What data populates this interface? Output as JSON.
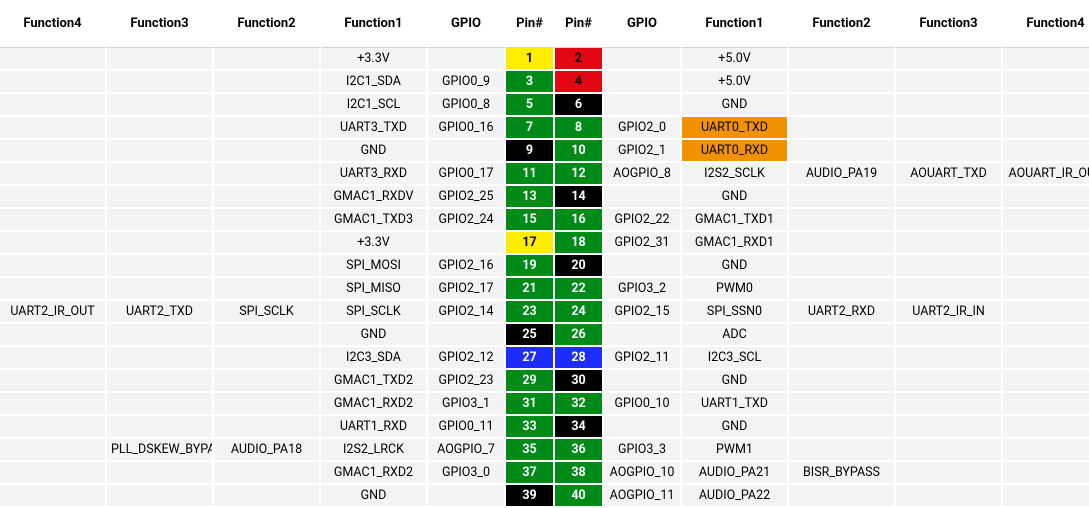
{
  "headers": {
    "f4l": "Function4",
    "f3l": "Function3",
    "f2l": "Function2",
    "f1l": "Function1",
    "gpiol": "GPIO",
    "pinl": "Pin#",
    "pinr": "Pin#",
    "gpior": "GPIO",
    "f1r": "Function1",
    "f2r": "Function2",
    "f3r": "Function3",
    "f4r": "Function4"
  },
  "rows": [
    {
      "f4l": "",
      "f3l": "",
      "f2l": "",
      "f1l": "+3.3V",
      "gpiol": "",
      "pinl": {
        "n": "1",
        "c": "yellow"
      },
      "pinr": {
        "n": "2",
        "c": "red"
      },
      "gpior": "",
      "f1r": "+5.0V",
      "f1rC": "",
      "f2r": "",
      "f3r": "",
      "f4r": ""
    },
    {
      "f4l": "",
      "f3l": "",
      "f2l": "",
      "f1l": "I2C1_SDA",
      "gpiol": "GPIO0_9",
      "pinl": {
        "n": "3",
        "c": "green"
      },
      "pinr": {
        "n": "4",
        "c": "red"
      },
      "gpior": "",
      "f1r": "+5.0V",
      "f1rC": "",
      "f2r": "",
      "f3r": "",
      "f4r": ""
    },
    {
      "f4l": "",
      "f3l": "",
      "f2l": "",
      "f1l": "I2C1_SCL",
      "gpiol": "GPIO0_8",
      "pinl": {
        "n": "5",
        "c": "green"
      },
      "pinr": {
        "n": "6",
        "c": "black"
      },
      "gpior": "",
      "f1r": "GND",
      "f1rC": "",
      "f2r": "",
      "f3r": "",
      "f4r": ""
    },
    {
      "f4l": "",
      "f3l": "",
      "f2l": "",
      "f1l": "UART3_TXD",
      "gpiol": "GPIO0_16",
      "pinl": {
        "n": "7",
        "c": "green"
      },
      "pinr": {
        "n": "8",
        "c": "green"
      },
      "gpior": "GPIO2_0",
      "f1r": "UART0_TXD",
      "f1rC": "orange",
      "f2r": "",
      "f3r": "",
      "f4r": ""
    },
    {
      "f4l": "",
      "f3l": "",
      "f2l": "",
      "f1l": "GND",
      "gpiol": "",
      "pinl": {
        "n": "9",
        "c": "black"
      },
      "pinr": {
        "n": "10",
        "c": "green"
      },
      "gpior": "GPIO2_1",
      "f1r": "UART0_RXD",
      "f1rC": "orange",
      "f2r": "",
      "f3r": "",
      "f4r": ""
    },
    {
      "f4l": "",
      "f3l": "",
      "f2l": "",
      "f1l": "UART3_RXD",
      "gpiol": "GPIO0_17",
      "pinl": {
        "n": "11",
        "c": "green"
      },
      "pinr": {
        "n": "12",
        "c": "green"
      },
      "gpior": "AOGPIO_8",
      "f1r": "I2S2_SCLK",
      "f1rC": "",
      "f2r": "AUDIO_PA19",
      "f3r": "AOUART_TXD",
      "f4r": "AOUART_IR_OUT"
    },
    {
      "f4l": "",
      "f3l": "",
      "f2l": "",
      "f1l": "GMAC1_RXDV",
      "gpiol": "GPIO2_25",
      "pinl": {
        "n": "13",
        "c": "green"
      },
      "pinr": {
        "n": "14",
        "c": "black"
      },
      "gpior": "",
      "f1r": "GND",
      "f1rC": "",
      "f2r": "",
      "f3r": "",
      "f4r": ""
    },
    {
      "f4l": "",
      "f3l": "",
      "f2l": "",
      "f1l": "GMAC1_TXD3",
      "gpiol": "GPIO2_24",
      "pinl": {
        "n": "15",
        "c": "green"
      },
      "pinr": {
        "n": "16",
        "c": "green"
      },
      "gpior": "GPIO2_22",
      "f1r": "GMAC1_TXD1",
      "f1rC": "",
      "f2r": "",
      "f3r": "",
      "f4r": ""
    },
    {
      "f4l": "",
      "f3l": "",
      "f2l": "",
      "f1l": "+3.3V",
      "gpiol": "",
      "pinl": {
        "n": "17",
        "c": "yellow"
      },
      "pinr": {
        "n": "18",
        "c": "green"
      },
      "gpior": "GPIO2_31",
      "f1r": "GMAC1_RXD1",
      "f1rC": "",
      "f2r": "",
      "f3r": "",
      "f4r": ""
    },
    {
      "f4l": "",
      "f3l": "",
      "f2l": "",
      "f1l": "SPI_MOSI",
      "gpiol": "GPIO2_16",
      "pinl": {
        "n": "19",
        "c": "green"
      },
      "pinr": {
        "n": "20",
        "c": "black"
      },
      "gpior": "",
      "f1r": "GND",
      "f1rC": "",
      "f2r": "",
      "f3r": "",
      "f4r": ""
    },
    {
      "f4l": "",
      "f3l": "",
      "f2l": "",
      "f1l": "SPI_MISO",
      "gpiol": "GPIO2_17",
      "pinl": {
        "n": "21",
        "c": "green"
      },
      "pinr": {
        "n": "22",
        "c": "green"
      },
      "gpior": "GPIO3_2",
      "f1r": "PWM0",
      "f1rC": "",
      "f2r": "",
      "f3r": "",
      "f4r": ""
    },
    {
      "f4l": "UART2_IR_OUT",
      "f3l": "UART2_TXD",
      "f2l": "SPI_SCLK",
      "f1l": "SPI_SCLK",
      "gpiol": "GPIO2_14",
      "pinl": {
        "n": "23",
        "c": "green"
      },
      "pinr": {
        "n": "24",
        "c": "green"
      },
      "gpior": "GPIO2_15",
      "f1r": "SPI_SSN0",
      "f1rC": "",
      "f2r": "UART2_RXD",
      "f3r": "UART2_IR_IN",
      "f4r": ""
    },
    {
      "f4l": "",
      "f3l": "",
      "f2l": "",
      "f1l": "GND",
      "gpiol": "",
      "pinl": {
        "n": "25",
        "c": "black"
      },
      "pinr": {
        "n": "26",
        "c": "green"
      },
      "gpior": "",
      "f1r": "ADC",
      "f1rC": "",
      "f2r": "",
      "f3r": "",
      "f4r": ""
    },
    {
      "f4l": "",
      "f3l": "",
      "f2l": "",
      "f1l": "I2C3_SDA",
      "gpiol": "GPIO2_12",
      "pinl": {
        "n": "27",
        "c": "blue"
      },
      "pinr": {
        "n": "28",
        "c": "blue"
      },
      "gpior": "GPIO2_11",
      "f1r": "I2C3_SCL",
      "f1rC": "",
      "f2r": "",
      "f3r": "",
      "f4r": ""
    },
    {
      "f4l": "",
      "f3l": "",
      "f2l": "",
      "f1l": "GMAC1_TXD2",
      "gpiol": "GPIO2_23",
      "pinl": {
        "n": "29",
        "c": "green"
      },
      "pinr": {
        "n": "30",
        "c": "black"
      },
      "gpior": "",
      "f1r": "GND",
      "f1rC": "",
      "f2r": "",
      "f3r": "",
      "f4r": ""
    },
    {
      "f4l": "",
      "f3l": "",
      "f2l": "",
      "f1l": "GMAC1_RXD2",
      "gpiol": "GPIO3_1",
      "pinl": {
        "n": "31",
        "c": "green"
      },
      "pinr": {
        "n": "32",
        "c": "green"
      },
      "gpior": "GPIO0_10",
      "f1r": "UART1_TXD",
      "f1rC": "",
      "f2r": "",
      "f3r": "",
      "f4r": ""
    },
    {
      "f4l": "",
      "f3l": "",
      "f2l": "",
      "f1l": "UART1_RXD",
      "gpiol": "GPIO0_11",
      "pinl": {
        "n": "33",
        "c": "green"
      },
      "pinr": {
        "n": "34",
        "c": "black"
      },
      "gpior": "",
      "f1r": "GND",
      "f1rC": "",
      "f2r": "",
      "f3r": "",
      "f4r": ""
    },
    {
      "f4l": "",
      "f3l": "PLL_DSKEW_BYPASS",
      "f2l": "AUDIO_PA18",
      "f1l": "I2S2_LRCK",
      "gpiol": "AOGPIO_7",
      "pinl": {
        "n": "35",
        "c": "green"
      },
      "pinr": {
        "n": "36",
        "c": "green"
      },
      "gpior": "GPIO3_3",
      "f1r": "PWM1",
      "f1rC": "",
      "f2r": "",
      "f3r": "",
      "f4r": ""
    },
    {
      "f4l": "",
      "f3l": "",
      "f2l": "",
      "f1l": "GMAC1_RXD2",
      "gpiol": "GPIO3_0",
      "pinl": {
        "n": "37",
        "c": "green"
      },
      "pinr": {
        "n": "38",
        "c": "green"
      },
      "gpior": "AOGPIO_10",
      "f1r": "AUDIO_PA21",
      "f1rC": "",
      "f2r": "BISR_BYPASS",
      "f3r": "",
      "f4r": ""
    },
    {
      "f4l": "",
      "f3l": "",
      "f2l": "",
      "f1l": "GND",
      "gpiol": "",
      "pinl": {
        "n": "39",
        "c": "black"
      },
      "pinr": {
        "n": "40",
        "c": "green"
      },
      "gpior": "AOGPIO_11",
      "f1r": "AUDIO_PA22",
      "f1rC": "",
      "f2r": "",
      "f3r": "",
      "f4r": ""
    }
  ]
}
